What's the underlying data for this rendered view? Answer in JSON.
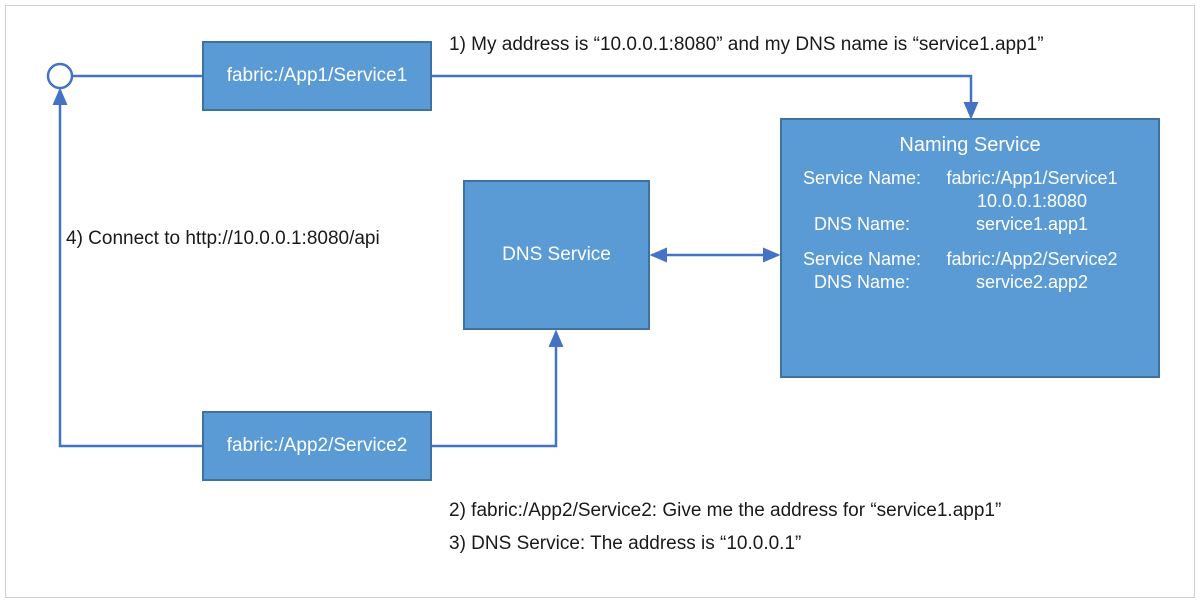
{
  "boxes": {
    "service1": "fabric:/App1/Service1",
    "service2": "fabric:/App2/Service2",
    "dns": "DNS Service"
  },
  "naming": {
    "title": "Naming Service",
    "entries": [
      {
        "serviceNameLabel": "Service Name:",
        "serviceName": "fabric:/App1/Service1",
        "address": "10.0.0.1:8080",
        "dnsNameLabel": "DNS Name:",
        "dnsName": "service1.app1"
      },
      {
        "serviceNameLabel": "Service Name:",
        "serviceName": "fabric:/App2/Service2",
        "dnsNameLabel": "DNS Name:",
        "dnsName": "service2.app2"
      }
    ]
  },
  "labels": {
    "step1": "1) My address is “10.0.0.1:8080” and my DNS name is “service1.app1”",
    "step2": "2) fabric:/App2/Service2: Give me the address for “service1.app1”",
    "step3": "3) DNS Service: The address is “10.0.0.1”",
    "step4": "4) Connect to http://10.0.0.1:8080/api"
  },
  "colors": {
    "boxFill": "#5b9bd5",
    "boxBorder": "#3e72a0",
    "arrow": "#4472c4"
  }
}
